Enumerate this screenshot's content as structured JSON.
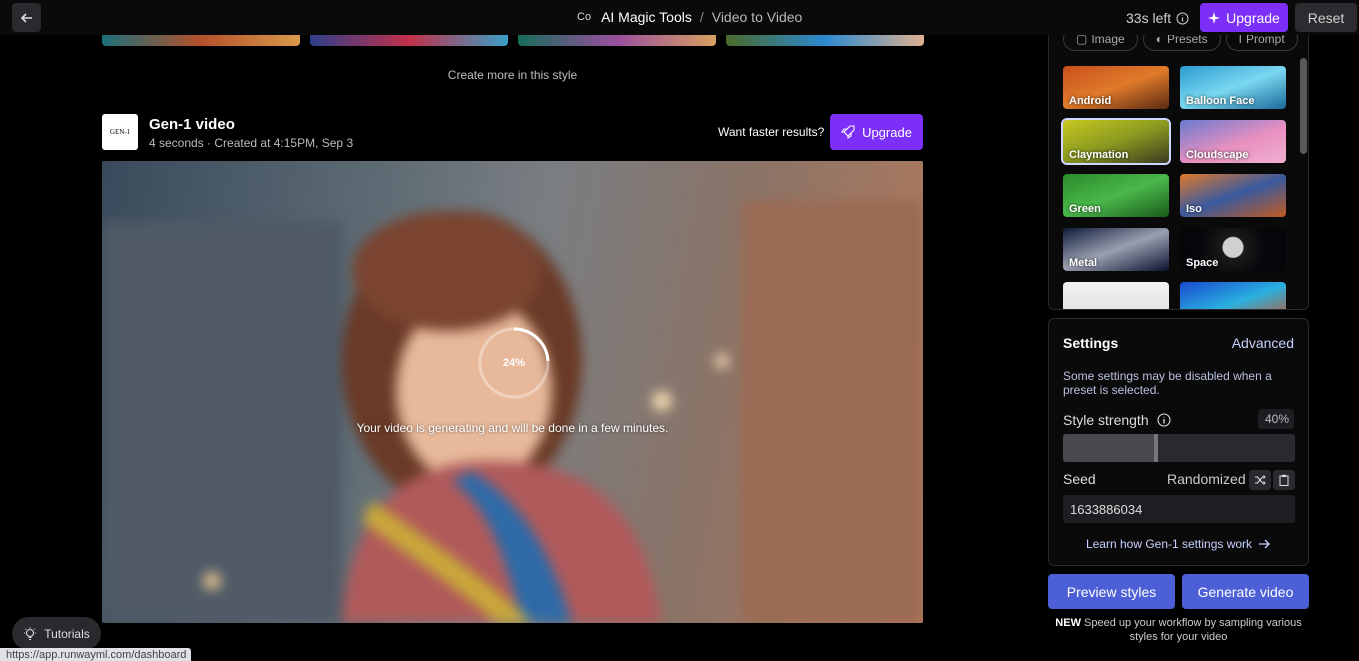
{
  "topbar": {
    "app_logo": "Co",
    "crumb_tool": "AI Magic Tools",
    "crumb_sep": "/",
    "crumb_page": "Video to Video",
    "time_left": "33s left",
    "upgrade_label": "Upgrade",
    "reset_label": "Reset"
  },
  "gallery": {
    "create_more": "Create more in this style"
  },
  "job": {
    "logo_text": "GEN-1",
    "title": "Gen-1 video",
    "meta": "4 seconds · Created at 4:15PM, Sep 3",
    "faster_prompt": "Want faster results?",
    "upgrade_label": "Upgrade",
    "progress_text": "24%",
    "progress_value": 0.24,
    "status_message": "Your video is generating and will be done in a few minutes."
  },
  "presets": {
    "tabs": [
      {
        "label": "Image"
      },
      {
        "label": "Presets"
      },
      {
        "label": "Prompt"
      }
    ],
    "items": [
      {
        "label": "Android"
      },
      {
        "label": "Balloon Face"
      },
      {
        "label": "Claymation"
      },
      {
        "label": "Cloudscape"
      },
      {
        "label": "Green"
      },
      {
        "label": "Iso"
      },
      {
        "label": "Metal"
      },
      {
        "label": "Space"
      },
      {
        "label": ""
      },
      {
        "label": ""
      }
    ],
    "selected": "Claymation"
  },
  "settings": {
    "title": "Settings",
    "advanced_label": "Advanced",
    "note": "Some settings may be disabled when a preset is selected.",
    "style_strength_label": "Style strength",
    "style_strength_value": "40%",
    "style_strength_fraction": 0.4,
    "seed_label": "Seed",
    "randomized_label": "Randomized",
    "seed_value": "1633886034",
    "learn_link": "Learn how Gen-1 settings work"
  },
  "actions": {
    "preview_label": "Preview styles",
    "generate_label": "Generate video",
    "new_badge": "NEW",
    "new_note": "Speed up your workflow by sampling various styles for your video"
  },
  "footer": {
    "tutorials_label": "Tutorials",
    "status_url": "https://app.runwayml.com/dashboard"
  },
  "colors": {
    "accent_purple": "#7b2ff7",
    "action_blue": "#4d5fd6",
    "link_blue": "#c8d0ff"
  }
}
